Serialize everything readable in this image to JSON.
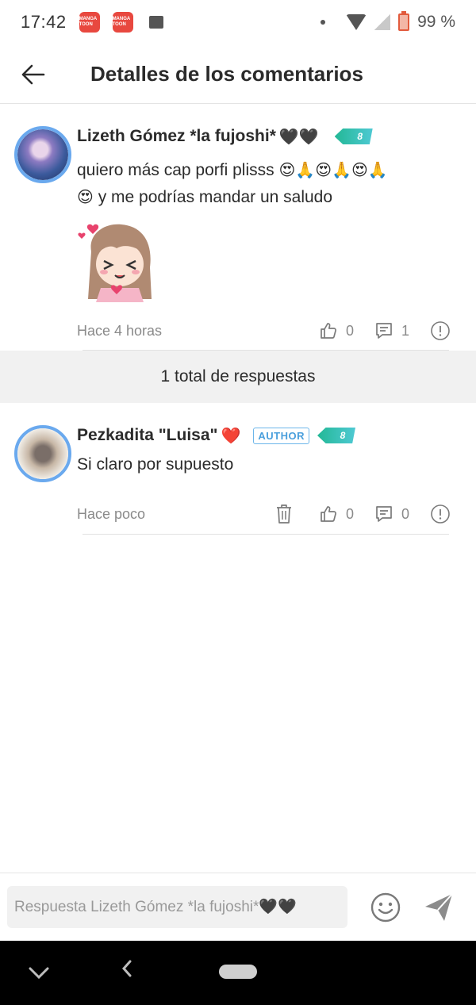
{
  "status_bar": {
    "time": "17:42",
    "app_icon_label": "MANGA TOON",
    "battery": "99 %"
  },
  "app_bar": {
    "title": "Detalles de los comentarios"
  },
  "comment": {
    "user_name": "Lizeth Gómez *la fujoshi*",
    "name_suffix": "🖤🖤",
    "level": "8",
    "text_line1": "quiero más cap porfi plisss",
    "text_line1_emoji": "😍🙏😍🙏😍🙏",
    "text_line2_emoji": "😍",
    "text_line2": "y me podrías mandar un saludo",
    "timestamp": "Hace 4 horas",
    "likes": "0",
    "replies": "1"
  },
  "replies_header": {
    "label": "1 total de respuestas"
  },
  "reply": {
    "user_name": "Pezkadita \"Luisa\"",
    "name_suffix": "❤️",
    "author_badge": "AUTHOR",
    "level": "8",
    "text": "Si claro por supuesto",
    "timestamp": "Hace poco",
    "likes": "0",
    "replies": "0"
  },
  "reply_bar": {
    "placeholder": "Respuesta Lizeth Gómez *la fujoshi*🖤🖤"
  },
  "icons": {
    "back": "arrow-left-icon",
    "like": "thumbs-up-icon",
    "reply": "comment-icon",
    "report": "alert-circle-icon",
    "delete": "trash-icon",
    "emoji": "smiley-icon",
    "send": "send-icon"
  },
  "colors": {
    "accent_blue": "#4a9fdc",
    "level_teal": "#23b896",
    "muted_text": "#8a8a8a"
  }
}
